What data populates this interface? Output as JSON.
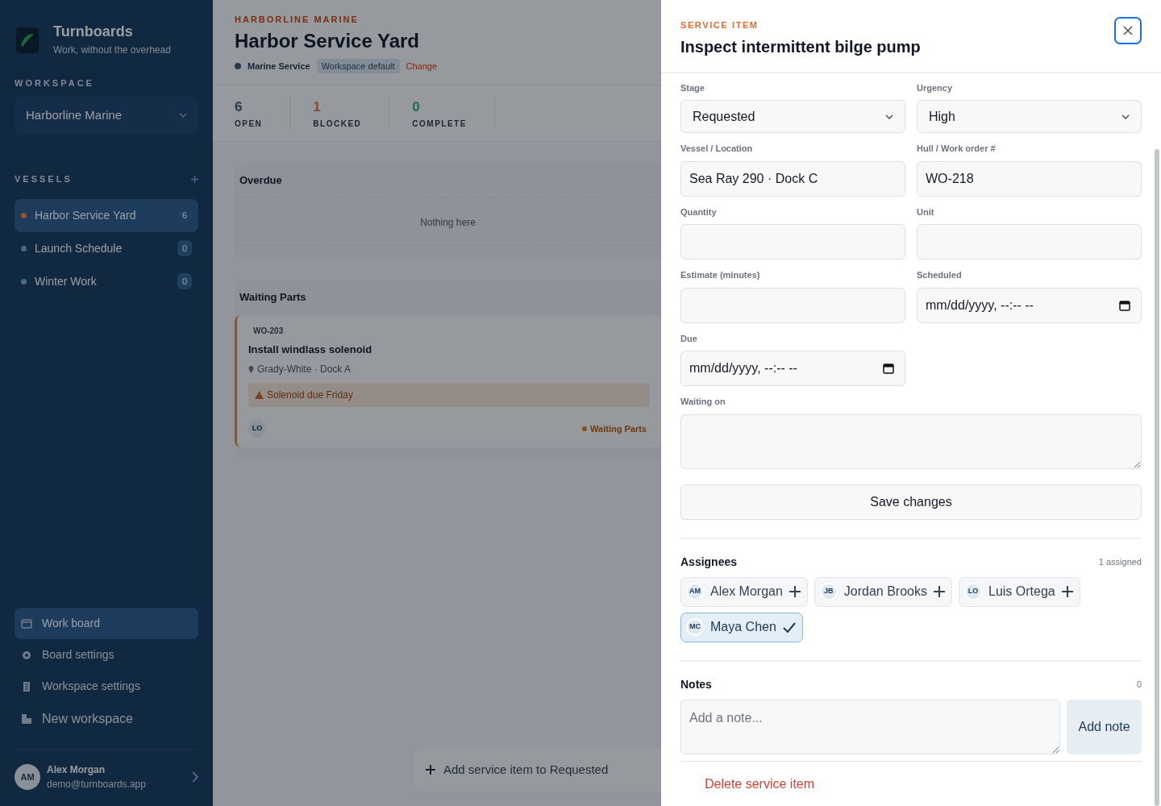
{
  "sidebar": {
    "brand": {
      "name": "Turnboards",
      "tagline": "Work, without the overhead"
    },
    "workspace_label": "WORKSPACE",
    "workspace_select": {
      "value": "Harborline Marine"
    },
    "vessels_label": "VESSELS",
    "vessels": [
      {
        "name": "Harbor Service Yard",
        "count": "6",
        "selected": true
      },
      {
        "name": "Launch Schedule",
        "count": "0",
        "selected": false
      },
      {
        "name": "Winter Work",
        "count": "0",
        "selected": false
      }
    ],
    "nav": [
      {
        "label": "Work board",
        "kind": "board",
        "selected": true
      },
      {
        "label": "Board settings",
        "kind": "gear",
        "selected": false
      },
      {
        "label": "Workspace settings",
        "kind": "building",
        "selected": false
      },
      {
        "label": "New workspace",
        "kind": "new",
        "selected": false
      }
    ],
    "user": {
      "initials": "AM",
      "name": "Alex Morgan",
      "email": "demo@turnboards.app"
    }
  },
  "main": {
    "eyebrow": "HARBORLINE MARINE",
    "title": "Harbor Service Yard",
    "template": "Marine Service",
    "template_badge": "Workspace default",
    "change_link": "Change",
    "stats": [
      {
        "value": "6",
        "label": "OPEN",
        "kind": "neutral"
      },
      {
        "value": "1",
        "label": "BLOCKED",
        "kind": "warn"
      },
      {
        "value": "0",
        "label": "COMPLETE",
        "kind": "good"
      }
    ],
    "lanes": [
      {
        "title": "Overdue",
        "empty": "Nothing here"
      },
      {
        "title": "Waiting Parts",
        "cards": [
          {
            "number": "WO-203",
            "title": "Install windlass solenoid",
            "location": "Grady-White · Dock A",
            "alert": "Solenoid due Friday",
            "assignee": "LO",
            "status": "Waiting Parts"
          }
        ]
      }
    ],
    "add_button": "Add service item to Requested"
  },
  "drawer": {
    "eyebrow": "SERVICE ITEM",
    "title": "Inspect intermittent bilge pump",
    "fields": [
      {
        "label": "Stage",
        "kind": "select",
        "value": "Requested"
      },
      {
        "label": "Urgency",
        "kind": "select",
        "value": "High"
      },
      {
        "label": "Vessel / Location",
        "kind": "input",
        "value": "Sea Ray 290 · Dock C"
      },
      {
        "label": "Hull / Work order #",
        "kind": "input",
        "value": "WO-218"
      },
      {
        "label": "Quantity",
        "kind": "input"
      },
      {
        "label": "Unit",
        "kind": "input"
      },
      {
        "label": "Estimate (minutes)",
        "kind": "input"
      },
      {
        "label": "Scheduled",
        "kind": "datetime",
        "placeholder": "mm/dd/yyyy, --:-- --"
      },
      {
        "label": "Due",
        "kind": "datetime",
        "placeholder": "mm/dd/yyyy, --:-- --"
      },
      {
        "label": "Waiting on",
        "kind": "textarea"
      }
    ],
    "save_button": "Save changes",
    "assignees": {
      "title": "Assignees",
      "count": "1 assigned",
      "people": [
        {
          "initials": "AM",
          "name": "Alex Morgan",
          "selected": false
        },
        {
          "initials": "JB",
          "name": "Jordan Brooks",
          "selected": false
        },
        {
          "initials": "LO",
          "name": "Luis Ortega",
          "selected": false
        },
        {
          "initials": "MC",
          "name": "Maya Chen",
          "selected": true
        }
      ]
    },
    "notes": {
      "title": "Notes",
      "count": "0",
      "placeholder": "Add a note...",
      "button": "Add note"
    },
    "delete_link": "Delete service item"
  }
}
